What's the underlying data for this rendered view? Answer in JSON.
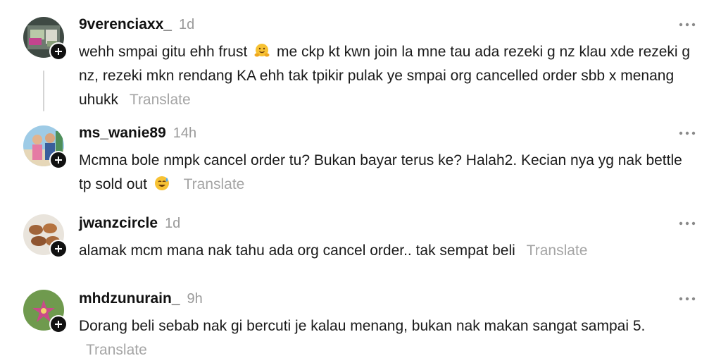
{
  "comments": [
    {
      "username": "9verenciaxx_",
      "time": "1d",
      "text_before_emoji": "wehh smpai gitu ehh frust",
      "emoji": "hugging-face-emoji",
      "text_after_emoji": "me ckp kt kwn join la mne tau ada rezeki g nz klau xde rezeki g nz, rezeki mkn rendang KA ehh tak tpikir pulak ye smpai org cancelled order sbb x menang uhukk",
      "translate_label": "Translate"
    },
    {
      "username": "ms_wanie89",
      "time": "14h",
      "text_before_emoji": "Mcmna bole nmpk cancel order tu? Bukan bayar terus ke? Halah2. Kecian nya yg nak bettle tp sold out",
      "emoji": "sweat-smile-emoji",
      "text_after_emoji": "",
      "translate_label": "Translate"
    },
    {
      "username": "jwanzcircle",
      "time": "1d",
      "text_before_emoji": "alamak mcm mana nak tahu ada org cancel order.. tak sempat beli",
      "emoji": "",
      "text_after_emoji": "",
      "translate_label": "Translate"
    },
    {
      "username": "mhdzunurain_",
      "time": "9h",
      "text_before_emoji": "Dorang beli sebab nak gi bercuti je kalau menang, bukan nak makan sangat sampai 5.",
      "emoji": "",
      "text_after_emoji": "",
      "translate_label": "Translate"
    }
  ],
  "icons": {
    "more": "more-horizontal-icon",
    "follow": "plus-icon"
  },
  "colors": {
    "text": "#1a1a1a",
    "muted": "#9a9a9a",
    "translate": "#a5a5a5",
    "badge": "#111111",
    "thread_line": "#d4d4d4"
  }
}
